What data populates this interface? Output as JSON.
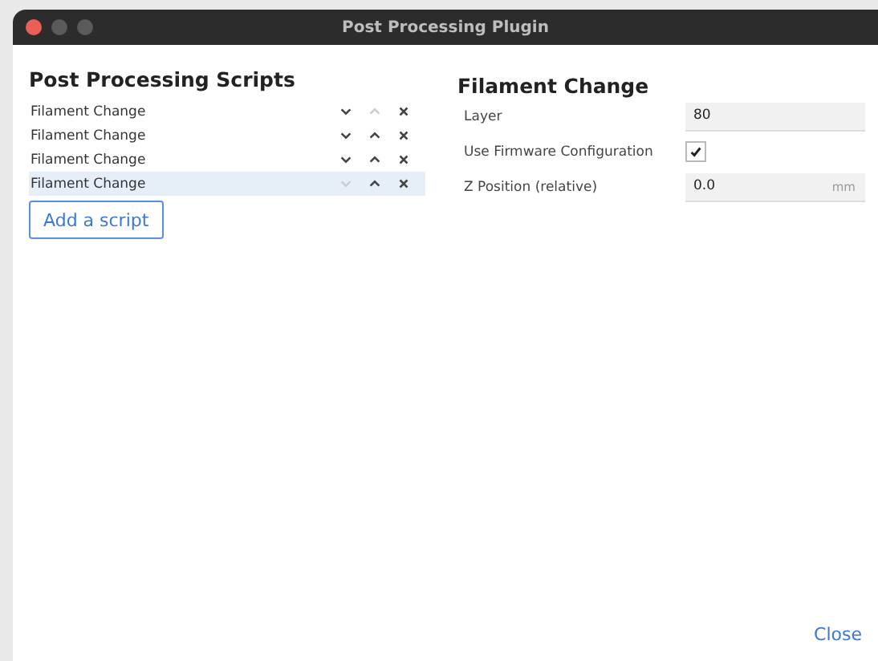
{
  "window": {
    "title": "Post Processing Plugin"
  },
  "scripts_panel": {
    "title": "Post Processing Scripts",
    "scripts": [
      {
        "label": "Filament Change",
        "selected": false,
        "down_disabled": false,
        "up_disabled": true
      },
      {
        "label": "Filament Change",
        "selected": false,
        "down_disabled": false,
        "up_disabled": false
      },
      {
        "label": "Filament Change",
        "selected": false,
        "down_disabled": false,
        "up_disabled": false
      },
      {
        "label": "Filament Change",
        "selected": true,
        "down_disabled": true,
        "up_disabled": false
      }
    ],
    "add_button": "Add a script"
  },
  "settings_panel": {
    "title": "Filament Change",
    "settings": [
      {
        "kind": "field",
        "label": "Layer",
        "value": "80"
      },
      {
        "kind": "checkbox",
        "label": "Use Firmware Configuration",
        "checked": true
      },
      {
        "kind": "field",
        "label": "Z Position (relative)",
        "value": "0.0",
        "unit": "mm"
      }
    ]
  },
  "close_button": "Close"
}
